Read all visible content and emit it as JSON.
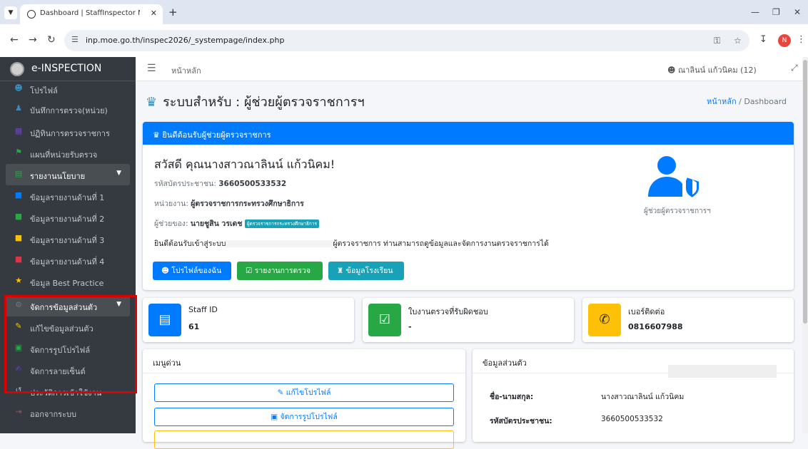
{
  "browser": {
    "tab_title": "Dashboard | StaffInspector Mo",
    "url": "inp.moe.go.th/inspec2026/_systempage/index.php",
    "profile_initial": "N"
  },
  "brand": {
    "name": "e-INSPECTION"
  },
  "sidebar": {
    "items": [
      {
        "label": "โปรไฟล์",
        "icon": "user-icon",
        "color": "#3c8dbc"
      },
      {
        "label": "บันทึกการตรวจ(หน่วย)",
        "icon": "users-icon",
        "color": "#3c8dbc"
      },
      {
        "label": "ปฏิทินการตรวจราชการ",
        "icon": "calendar-icon",
        "color": "#6f42c1"
      },
      {
        "label": "แผนที่หน่วยรับตรวจ",
        "icon": "map-icon",
        "color": "#28a745"
      },
      {
        "label": "รายงานนโยบาย",
        "icon": "file-icon",
        "color": "#28a745"
      },
      {
        "label": "ข้อมูลรายงานด้านที่ 1",
        "icon": "doc-icon",
        "color": "#007bff"
      },
      {
        "label": "ข้อมูลรายงานด้านที่ 2",
        "icon": "doc-icon",
        "color": "#28a745"
      },
      {
        "label": "ข้อมูลรายงานด้านที่ 3",
        "icon": "doc-icon",
        "color": "#ffc107"
      },
      {
        "label": "ข้อมูลรายงานด้านที่ 4",
        "icon": "doc-icon",
        "color": "#dc3545"
      },
      {
        "label": "ข้อมูล Best Practice",
        "icon": "award-icon",
        "color": "#ffc107"
      },
      {
        "label": "จัดการข้อมูลส่วนตัว",
        "icon": "cogs-icon",
        "color": "#6c757d"
      },
      {
        "label": "แก้ไขข้อมูลส่วนตัว",
        "icon": "user-edit-icon",
        "color": "#ffc107"
      },
      {
        "label": "จัดการรูปโปรไฟล์",
        "icon": "image-icon",
        "color": "#28a745"
      },
      {
        "label": "จัดการลายเซ็นต์",
        "icon": "signature-icon",
        "color": "#6f42c1"
      },
      {
        "label": "ประวัติการเข้าใช้งาน",
        "icon": "history-icon",
        "color": "#adb5bd"
      },
      {
        "label": "ออกจากระบบ",
        "icon": "logout-icon",
        "color": "#dc3545"
      }
    ]
  },
  "topnav": {
    "home": "หน้าหลัก",
    "user": "ณาลินน์ แก้วนิคม (12)"
  },
  "page": {
    "title": "ระบบสำหรับ : ผู้ช่วยผู้ตรวจราชการฯ",
    "breadcrumb_home": "หน้าหลัก",
    "breadcrumb_sep": "/",
    "breadcrumb_current": "Dashboard"
  },
  "welcome": {
    "header": "ยินดีต้อนรับผู้ช่วยผู้ตรวจราชการ",
    "greeting": "สวัสดี คุณนางสาวณาลินน์ แก้วนิคม!",
    "id_label": "รหัสบัตรประชาชน:",
    "id_value": "3660500533532",
    "unit_label": "หน่วยงาน:",
    "unit_value": "ผู้ตรวจราชการกระทรวงศึกษาธิการ",
    "assist_label": "ผู้ช่วยของ:",
    "assist_value": "นายชูสิน วรเดช",
    "assist_badge": "ผู้ตรวจราชการกระทรวงศึกษาธิการ",
    "message_start": "ยินดีต้อนรับเข้าสู่ระบบ",
    "message_end": "ผู้ตรวจราชการ ท่านสามารถดูข้อมูลและจัดการงานตรวจราชการได้",
    "role_label": "ผู้ช่วยผู้ตรวจราชการฯ",
    "buttons": {
      "profile": "โปรไฟล์ของฉัน",
      "report": "รายงานการตรวจ",
      "school": "ข้อมูลโรงเรียน"
    }
  },
  "info_boxes": [
    {
      "title": "Staff ID",
      "value": "61",
      "color": "#007bff"
    },
    {
      "title": "ใบงานตรวจที่รับผิดชอบ",
      "value": "-",
      "color": "#28a745"
    },
    {
      "title": "เบอร์ติดต่อ",
      "value": "0816607988",
      "color": "#ffc107"
    }
  ],
  "quick_menu": {
    "title": "เมนูด่วน",
    "items": [
      "แก้ไขโปรไฟล์",
      "จัดการรูปโปรไฟล์"
    ]
  },
  "personal": {
    "title": "ข้อมูลส่วนตัว",
    "name_label": "ชื่อ-นามสกุล:",
    "name_value": "นางสาวณาลินน์ แก้วนิคม",
    "id_label": "รหัสบัตรประชาชน:",
    "id_value": "3660500533532"
  }
}
